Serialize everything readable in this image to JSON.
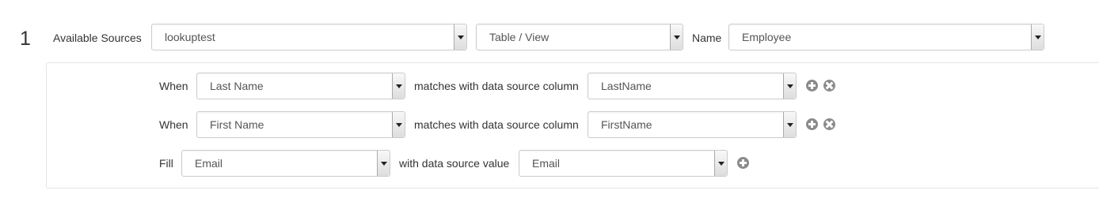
{
  "row_number": "1",
  "header": {
    "available_sources_label": "Available Sources",
    "source_value": "lookuptest",
    "type_value": "Table / View",
    "name_label": "Name",
    "name_value": "Employee"
  },
  "conditions": [
    {
      "keyword": "When",
      "field": "Last Name",
      "connector": "matches with data source column",
      "column": "LastName"
    },
    {
      "keyword": "When",
      "field": "First Name",
      "connector": "matches with data source column",
      "column": "FirstName"
    }
  ],
  "fill": {
    "keyword": "Fill",
    "field": "Email",
    "connector": "with data source value",
    "value": "Email"
  },
  "icons": {
    "add": "plus-circle-icon",
    "remove": "close-circle-icon",
    "dropdown": "chevron-down-icon"
  }
}
